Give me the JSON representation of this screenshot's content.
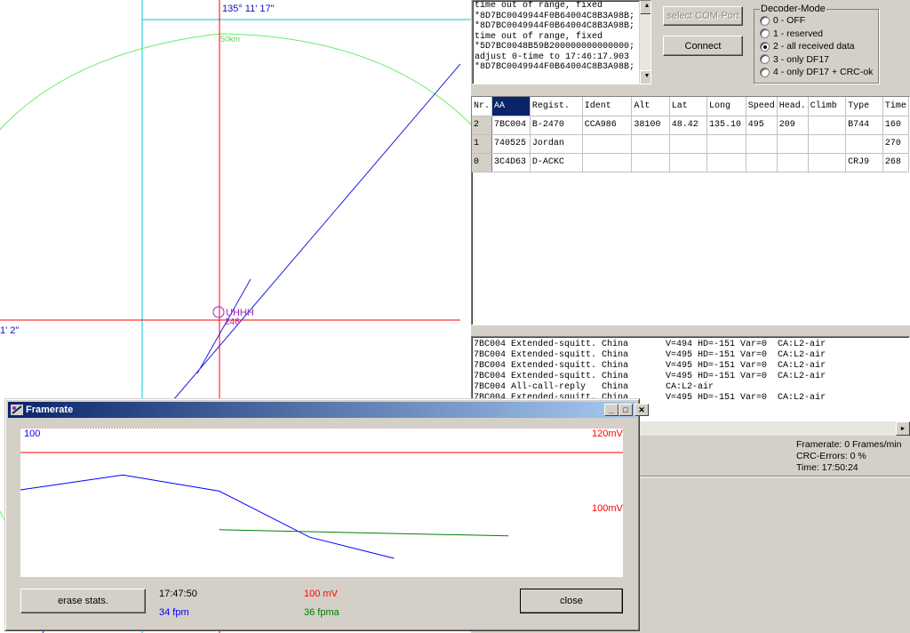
{
  "radar": {
    "longitude_label": "135° 11' 17\"",
    "latitude_label": "1' 2\"",
    "range_ring_label": "50km",
    "airport_label": "UHHH",
    "airport_sub_label": "246",
    "colors": {
      "crosshair": "#ff0000",
      "grid": "#00c8d8",
      "ring": "#66ee66",
      "track": "#2222dd",
      "airport": "#a020c0",
      "label": "#1010c0"
    }
  },
  "log": {
    "lines": [
      "time out of range, fixed",
      "*8D7BC0049944F0B64004C8B3A98B;",
      "*8D7BC0049944F0B64004C8B3A98B;",
      "time out of range, fixed",
      "*5D7BC0048B59B200000000000000;",
      "adjust 0-time to 17:46:17.903",
      "*8D7BC0049944F0B64004C8B3A98B;"
    ]
  },
  "buttons": {
    "select_com_port": "select COM-Port",
    "connect": "Connect"
  },
  "decoder_mode": {
    "legend": "Decoder-Mode",
    "selected": 2,
    "options": [
      "0 - OFF",
      "1 - reserved",
      "2 - all received data",
      "3 - only DF17",
      "4 - only DF17 + CRC-ok"
    ]
  },
  "aircraft_table": {
    "headers": [
      "Nr.",
      "AA",
      "Regist.",
      "Ident",
      "Alt",
      "Lat",
      "Long",
      "Speed",
      "Head.",
      "Climb",
      "Type",
      "Time"
    ],
    "rows": [
      [
        "2",
        "7BC004",
        "B-2470",
        "CCA986",
        "38100",
        "48.42",
        "135.10",
        "495",
        "209",
        "",
        "B744",
        "160"
      ],
      [
        "1",
        "740525",
        "Jordan",
        "",
        "",
        "",
        "",
        "",
        "",
        "",
        "",
        "270"
      ],
      [
        "0",
        "3C4D63",
        "D-ACKC",
        "",
        "",
        "",
        "",
        "",
        "",
        "",
        "CRJ9",
        "268"
      ]
    ]
  },
  "messages": {
    "lines": [
      "7BC004 Extended-squitt. China       V=494 HD=-151 Var=0  CA:L2-air",
      "7BC004 Extended-squitt. China       V=495 HD=-151 Var=0  CA:L2-air",
      "7BC004 Extended-squitt. China       V=495 HD=-151 Var=0  CA:L2-air",
      "7BC004 Extended-squitt. China       V=495 HD=-151 Var=0  CA:L2-air",
      "7BC004 All-call-reply   China       CA:L2-air",
      "7BC004 Extended-squitt. China       V=495 HD=-151 Var=0  CA:L2-air"
    ]
  },
  "status": {
    "framerate": "Framerate:  0 Frames/min",
    "crc_errors": "CRC-Errors: 0 %",
    "time": "Time: 17:50:24"
  },
  "framerate_dialog": {
    "title": "Framerate",
    "graph": {
      "left_max_label": "100",
      "right_max_label": "120mV",
      "right_mid_label": "100mV"
    },
    "erase_button": "erase stats.",
    "close_button": "close",
    "time": "17:47:50",
    "fpm": "34 fpm",
    "mv": "100 mV",
    "fpma": "36 fpma",
    "colors": {
      "fpm": "#0000ff",
      "mv": "#ff0000",
      "fpma": "#008000"
    }
  },
  "chart_data": {
    "type": "line",
    "title": "",
    "ylim_left": [
      0,
      100
    ],
    "ylim_right_mV_labels": [
      "120mV",
      "100mV"
    ],
    "series": [
      {
        "name": "fpm",
        "color": "#0000ff",
        "points": [
          [
            0,
            70
          ],
          [
            17,
            82
          ],
          [
            33,
            69
          ],
          [
            48,
            32
          ],
          [
            62,
            15
          ]
        ]
      },
      {
        "name": "mV",
        "color": "#ff0000",
        "points": [
          [
            0,
            100
          ],
          [
            100,
            100
          ]
        ]
      },
      {
        "name": "fpma",
        "color": "#008000",
        "points": [
          [
            33,
            38
          ],
          [
            81,
            33
          ]
        ]
      }
    ]
  }
}
